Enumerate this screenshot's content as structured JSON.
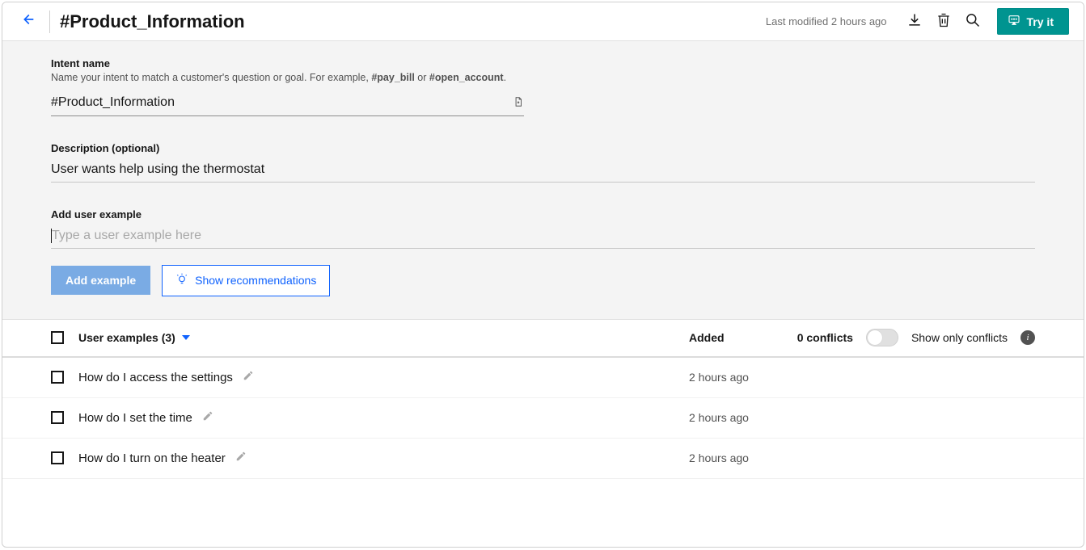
{
  "header": {
    "title": "#Product_Information",
    "last_modified": "Last modified 2 hours ago",
    "try_it_label": "Try it"
  },
  "intent_name": {
    "label": "Intent name",
    "help_prefix": "Name your intent to match a customer's question or goal. For example, ",
    "help_ex1": "#pay_bill",
    "help_mid": " or ",
    "help_ex2": "#open_account",
    "help_suffix": ".",
    "value": "#Product_Information"
  },
  "description": {
    "label": "Description (optional)",
    "value": "User wants help using the thermostat"
  },
  "add_example": {
    "label": "Add user example",
    "placeholder": "Type a user example here",
    "add_button": "Add example",
    "recommend_button": "Show recommendations"
  },
  "table": {
    "examples_header": "User examples (3)",
    "added_header": "Added",
    "conflicts": "0 conflicts",
    "show_only": "Show only conflicts",
    "rows": [
      {
        "text": "How do I access the settings",
        "added": "2 hours ago"
      },
      {
        "text": "How do I set the time",
        "added": "2 hours ago"
      },
      {
        "text": "How do I turn on the heater",
        "added": "2 hours ago"
      }
    ]
  }
}
